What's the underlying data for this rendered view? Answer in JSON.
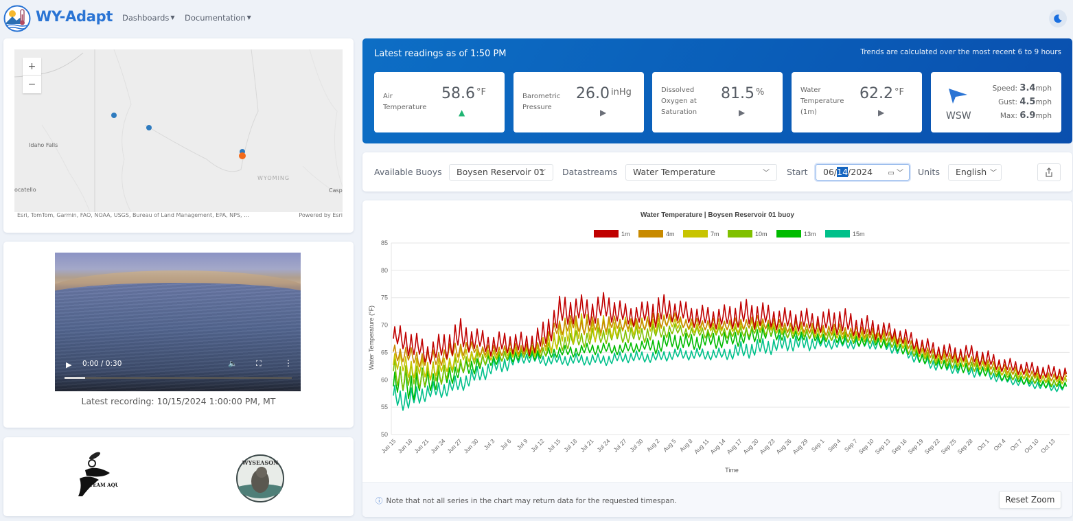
{
  "navbar": {
    "brand": "WY-Adapt",
    "menus": [
      {
        "label": "Dashboards"
      },
      {
        "label": "Documentation"
      }
    ],
    "theme_toggle_icon": "moon-icon"
  },
  "map": {
    "zoom_in": "+",
    "zoom_out": "−",
    "labels": {
      "idaho_falls": "Idaho Falls",
      "pocatello": "ocatello",
      "wyoming": "WYOMING",
      "casper": "Casp"
    },
    "attribution": "Esri, TomTom, Garmin, FAO, NOAA, USGS, Bureau of Land Management, EPA, NPS, ...",
    "powered_by": "Powered by Esri",
    "markers": [
      {
        "type": "buoy",
        "color": "#2e7bbf"
      },
      {
        "type": "buoy",
        "color": "#2e7bbf"
      },
      {
        "type": "buoy",
        "color": "#2e7bbf"
      },
      {
        "type": "selected-buoy",
        "color": "#f26a1b"
      }
    ]
  },
  "video": {
    "time": "0:00 / 0:30",
    "progress_fraction": 0.09,
    "caption": "Latest recording: 10/15/2024 1:00:00 PM, MT"
  },
  "partners": [
    {
      "name": "Team Aquatic",
      "text": "TEAM AQUATIC"
    },
    {
      "name": "WySeason",
      "text": "WYSEASON"
    }
  ],
  "readings": {
    "title": "Latest readings as of 1:50 PM",
    "note": "Trends are calculated over the most recent 6 to 9 hours",
    "cards": [
      {
        "label": "Air Temperature",
        "value": "58.6",
        "unit": "°F",
        "trend": "up",
        "trend_color": "#20b573"
      },
      {
        "label": "Barometric Pressure",
        "value": "26.0",
        "unit": "inHg",
        "trend": "steady",
        "trend_color": "#6b6f78"
      },
      {
        "label": "Dissolved Oxygen at Saturation",
        "value": "81.5",
        "unit": "%",
        "trend": "steady",
        "trend_color": "#6b6f78"
      },
      {
        "label": "Water Temperature (1m)",
        "value": "62.2",
        "unit": "°F",
        "trend": "steady",
        "trend_color": "#6b6f78"
      }
    ],
    "wind": {
      "direction": "WSW",
      "speed_label": "Speed:",
      "speed": "3.4",
      "speed_unit": "mph",
      "gust_label": "Gust:",
      "gust": "4.5",
      "gust_unit": "mph",
      "max_label": "Max:",
      "max": "6.9",
      "max_unit": "mph",
      "arrow_color": "#2a74d4"
    }
  },
  "controls": {
    "buoys_label": "Available Buoys",
    "buoy_selected": "Boysen Reservoir 01",
    "datastreams_label": "Datastreams",
    "datastream_selected": "Water Temperature",
    "start_label": "Start",
    "start_month": "06",
    "start_day": "14",
    "start_year": "2024",
    "units_label": "Units",
    "units_selected": "English"
  },
  "chart_footer": {
    "note": "Note that not all series in the chart may return data for the requested timespan.",
    "reset_zoom": "Reset Zoom"
  },
  "chart_data": {
    "type": "line",
    "title": "Water Temperature | Boysen Reservoir 01 buoy",
    "xlabel": "Time",
    "ylabel": "Water Temperature (°F)",
    "ylim": [
      50,
      85
    ],
    "yticks": [
      50,
      55,
      60,
      65,
      70,
      75,
      80,
      85
    ],
    "grid": true,
    "legend_position": "top-center",
    "x": [
      "Jun 15",
      "Jun 18",
      "Jun 21",
      "Jun 24",
      "Jun 27",
      "Jun 30",
      "Jul 3",
      "Jul 6",
      "Jul 9",
      "Jul 12",
      "Jul 15",
      "Jul 18",
      "Jul 21",
      "Jul 24",
      "Jul 27",
      "Jul 30",
      "Aug 2",
      "Aug 5",
      "Aug 8",
      "Aug 11",
      "Aug 14",
      "Aug 17",
      "Aug 20",
      "Aug 23",
      "Aug 26",
      "Aug 29",
      "Sep 1",
      "Sep 4",
      "Sep 7",
      "Sep 10",
      "Sep 13",
      "Sep 16",
      "Sep 19",
      "Sep 22",
      "Sep 25",
      "Sep 28",
      "Oct 1",
      "Oct 4",
      "Oct 7",
      "Oct 10",
      "Oct 13"
    ],
    "series": [
      {
        "name": "1m",
        "color": "#c00000",
        "values": [
          67.5,
          66.5,
          64.5,
          65.5,
          67.5,
          67,
          66,
          66.5,
          66,
          67,
          71.5,
          72.5,
          72,
          73,
          71.5,
          71.5,
          72,
          72.5,
          71.5,
          71,
          71,
          71.5,
          71.5,
          71,
          70.5,
          70.5,
          70,
          70.5,
          69.5,
          69,
          68.5,
          67.5,
          66,
          65,
          64.5,
          64.5,
          63.5,
          62.5,
          62,
          61.5,
          61
        ],
        "daily_range": [
          4,
          5,
          4,
          5,
          6,
          4,
          4,
          4,
          4,
          5,
          6,
          5,
          5,
          5,
          4,
          4,
          6,
          4,
          4,
          4,
          4,
          5,
          5,
          4,
          4,
          4,
          4,
          5,
          4,
          4,
          3,
          3,
          3,
          3,
          3,
          3,
          3,
          2.5,
          2.5,
          2.5,
          2.5
        ]
      },
      {
        "name": "4m",
        "color": "#c88a00",
        "values": [
          65,
          64,
          63.5,
          64,
          65.5,
          65.5,
          65,
          65.5,
          65.5,
          66,
          69.5,
          70,
          69.5,
          70,
          70,
          70,
          70.5,
          71,
          70,
          70,
          70,
          70,
          70.5,
          70,
          69.5,
          69.5,
          69,
          69,
          68.5,
          68.5,
          68,
          67,
          65.5,
          64.5,
          64,
          63.5,
          63,
          62,
          61.5,
          61,
          60.5
        ],
        "daily_range": [
          3,
          3,
          3,
          3,
          3,
          2,
          2,
          2,
          2,
          2,
          3,
          3,
          3,
          3,
          2,
          2,
          3,
          2,
          2,
          2,
          2,
          2,
          2,
          2,
          2,
          2,
          2,
          2,
          2,
          2,
          2,
          2,
          2,
          2,
          2,
          2,
          2,
          1.5,
          1.5,
          1.5,
          1.5
        ]
      },
      {
        "name": "7m",
        "color": "#c8c400",
        "values": [
          63,
          62,
          61.5,
          62,
          64,
          64.5,
          64.5,
          65,
          65,
          65.5,
          67.5,
          69,
          69,
          69,
          69.5,
          69.5,
          70,
          70.5,
          69.5,
          69.5,
          69.5,
          69.5,
          70,
          69.5,
          69,
          69,
          68.5,
          68.5,
          68,
          68,
          67.5,
          66.5,
          65,
          64,
          63.5,
          63,
          62.5,
          61.5,
          61,
          60.5,
          60
        ],
        "daily_range": [
          4,
          4,
          4,
          3,
          3,
          2,
          2,
          2,
          2,
          3,
          5,
          5,
          5,
          4,
          3,
          3,
          3,
          2,
          2,
          2,
          2,
          2,
          2,
          2,
          2,
          2,
          2,
          2,
          2,
          2,
          2,
          2,
          2,
          2,
          2,
          2,
          2,
          1.5,
          1.5,
          1.5,
          1.5
        ]
      },
      {
        "name": "10m",
        "color": "#80c000",
        "values": [
          61,
          60,
          60.5,
          61,
          62.5,
          63.5,
          64,
          64.5,
          65,
          65,
          66.5,
          67,
          67.5,
          68,
          68,
          68,
          68.5,
          69,
          68.5,
          68.5,
          68.5,
          68.5,
          69,
          69,
          68.5,
          68.5,
          68,
          68,
          67.5,
          67.5,
          67,
          66,
          64.5,
          63.5,
          63,
          62.5,
          62,
          61,
          60.5,
          60,
          59.5
        ],
        "daily_range": [
          5,
          5,
          4,
          4,
          3,
          3,
          2,
          2,
          2,
          2,
          3,
          3,
          3,
          3,
          3,
          3,
          3,
          2,
          2,
          2,
          2,
          2,
          2,
          2,
          2,
          2,
          2,
          2,
          2,
          2,
          2,
          2,
          2,
          2,
          2,
          2,
          2,
          1.5,
          1.5,
          1.5,
          1.5
        ]
      },
      {
        "name": "13m",
        "color": "#00bb00",
        "values": [
          59.5,
          58.5,
          59.5,
          60,
          61.5,
          62.5,
          63.5,
          64,
          64.5,
          64.5,
          65,
          65,
          65.5,
          65.5,
          65.5,
          66,
          66,
          67,
          66.5,
          67,
          67,
          67.5,
          68,
          68.5,
          68,
          68,
          67.5,
          67.5,
          67,
          67,
          66.5,
          65.5,
          64,
          63,
          62.5,
          62,
          61.5,
          60.5,
          60,
          59.5,
          59
        ],
        "daily_range": [
          5,
          6,
          4,
          4,
          3,
          3,
          2,
          2,
          2,
          2,
          2,
          2,
          2,
          2,
          2,
          2,
          3,
          3,
          3,
          3,
          3,
          3,
          3,
          3,
          2,
          2,
          2,
          2,
          2,
          2,
          2,
          2,
          2,
          2,
          2,
          2,
          2,
          1.5,
          1.5,
          1.5,
          1.5
        ]
      },
      {
        "name": "15m",
        "color": "#00c08a",
        "values": [
          56.5,
          56,
          57.5,
          58,
          59,
          60.5,
          62,
          63,
          64,
          63.5,
          63.5,
          63.5,
          63.5,
          63.5,
          64,
          64,
          64,
          64.5,
          64.5,
          64.5,
          64.5,
          65,
          65.5,
          66,
          66.5,
          66.5,
          66.5,
          66.5,
          66.5,
          66.5,
          66,
          65,
          63.5,
          62.5,
          62,
          61.5,
          61,
          60,
          59.5,
          59,
          58.5
        ],
        "daily_range": [
          4,
          4,
          3,
          3,
          3,
          3,
          3,
          3,
          2,
          2,
          2,
          2,
          2,
          2,
          2,
          2,
          2,
          2,
          2,
          2,
          2,
          3,
          3,
          3,
          3,
          3,
          2,
          2,
          2,
          2,
          2,
          2,
          2,
          2,
          2,
          2,
          2,
          1.5,
          1.5,
          1.5,
          1.5
        ]
      }
    ]
  }
}
